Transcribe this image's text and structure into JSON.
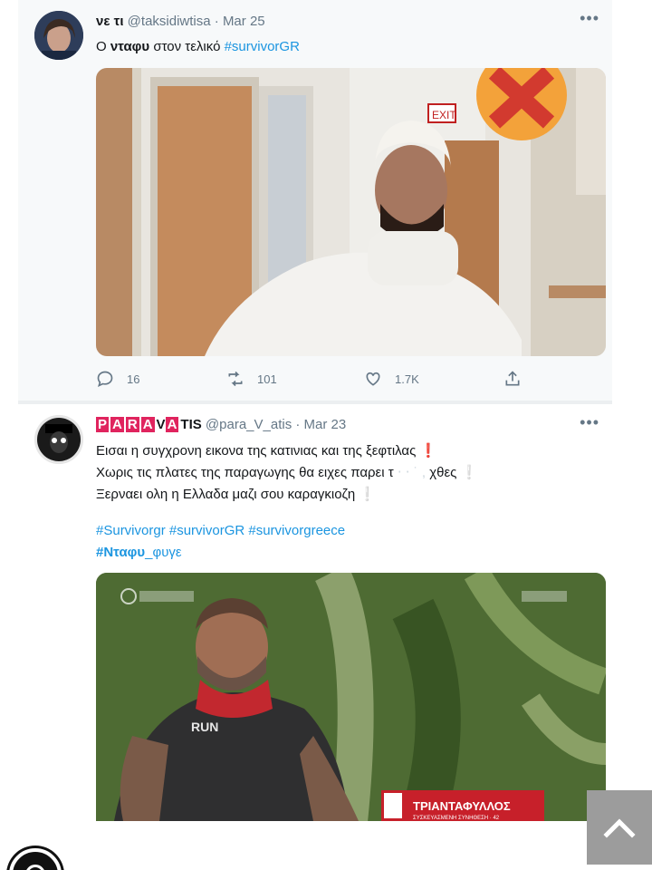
{
  "tweet1": {
    "display_name": "νε τι",
    "handle": "@taksidiwtisa",
    "separator": "·",
    "date": "Mar 25",
    "text_pre": "Ο ",
    "text_bold": "νταφυ",
    "text_mid": " στον τελικό ",
    "hashtag": "#survivorGR",
    "replies": "16",
    "retweets": "101",
    "likes": "1.7K",
    "image_text": "EXIT"
  },
  "tweet2": {
    "name_letters": [
      "P",
      "A",
      "R",
      "A",
      "V",
      "A"
    ],
    "name_tail": "TIS",
    "handle": "@para_V_atis",
    "separator": "·",
    "date": "Mar 23",
    "line1": "Εισαι η συγχρονη εικονα της κατινιας και της ξεφτιλας",
    "line1_mark": "❗",
    "line2": "Χωρις τις πλατες της παραγωγης θα ειχες παρει τ",
    "line2_end": "χθες",
    "line2_mark": "❕",
    "line3": "Ξερναει ολη η Ελλαδα μαζι σου καραγκιοζη",
    "line3_mark": "❕",
    "tags_line1": "#Survivorgr  #survivorGR #survivorgreece",
    "tag_bold": "#Νταφυ",
    "tag_tail": "_φυγε",
    "image_caption": "ΤΡΙΑΝΤΑΦΥΛΛΟΣ",
    "image_subcaption": "ΣΥΣΚΕΥΑΣΜΕΝΗ ΣΥΝΗΘΕΣΗ · 42",
    "shirt_text": "RUN"
  },
  "colors": {
    "accent": "#1b95e0",
    "text": "#14171a",
    "muted": "#657786",
    "name_box": "#e0245e"
  },
  "icons": [
    "reply-icon",
    "retweet-icon",
    "like-icon",
    "share-icon",
    "more-icon",
    "chevron-up-icon"
  ]
}
